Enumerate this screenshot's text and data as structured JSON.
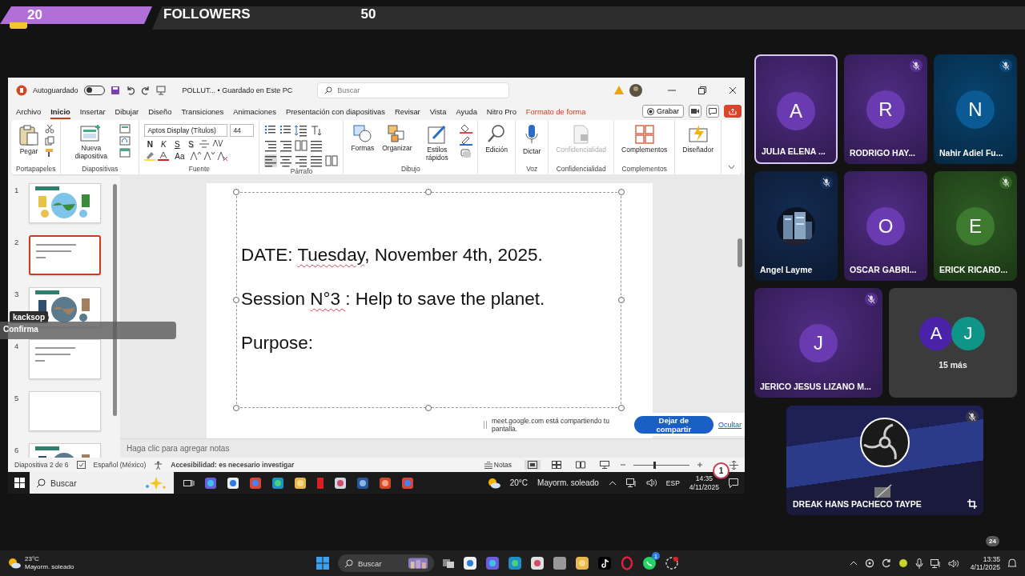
{
  "stream_overlay": {
    "left_count": "20",
    "title": "FOLLOWERS",
    "right_count": "50"
  },
  "powerpoint": {
    "title_bar": {
      "autosave_label": "Autoguardado",
      "autosave_on": false,
      "document": "POLLUT... • Guardado en Este PC",
      "search_placeholder": "Buscar"
    },
    "menu_tabs": [
      {
        "label": "Archivo",
        "selected": false,
        "kind": "tab"
      },
      {
        "label": "Inicio",
        "selected": true,
        "kind": "tab"
      },
      {
        "label": "Insertar",
        "selected": false,
        "kind": "tab"
      },
      {
        "label": "Dibujar",
        "selected": false,
        "kind": "tab"
      },
      {
        "label": "Diseño",
        "selected": false,
        "kind": "tab"
      },
      {
        "label": "Transiciones",
        "selected": false,
        "kind": "tab"
      },
      {
        "label": "Animaciones",
        "selected": false,
        "kind": "tab"
      },
      {
        "label": "Presentación con diapositivas",
        "selected": false,
        "kind": "tab"
      },
      {
        "label": "Revisar",
        "selected": false,
        "kind": "tab"
      },
      {
        "label": "Vista",
        "selected": false,
        "kind": "tab"
      },
      {
        "label": "Ayuda",
        "selected": false,
        "kind": "tab"
      },
      {
        "label": "Nitro Pro",
        "selected": false,
        "kind": "tab"
      },
      {
        "label": "Formato de forma",
        "selected": false,
        "kind": "contextual"
      }
    ],
    "record_button": "Grabar",
    "ribbon_groups": [
      {
        "label": "Portapapeles",
        "kind": "clipboard",
        "buttons": [
          {
            "label": "Pegar",
            "kind": "paste",
            "disabled": false
          }
        ]
      },
      {
        "label": "Diapositivas",
        "kind": "slides",
        "buttons": [
          {
            "label": "Nueva diapositiva",
            "kind": "new-slide",
            "disabled": false
          }
        ]
      },
      {
        "label": "Fuente",
        "kind": "font",
        "font_name": "Aptos Display (Títulos)",
        "font_size": "44",
        "format_buttons": [
          "N",
          "K",
          "S",
          "S"
        ],
        "case_button": "Aa"
      },
      {
        "label": "Párrafo",
        "kind": "paragraph"
      },
      {
        "label": "Dibujo",
        "kind": "drawing",
        "buttons": [
          {
            "label": "Formas",
            "kind": "shapes",
            "disabled": false
          },
          {
            "label": "Organizar",
            "kind": "arrange",
            "disabled": false
          },
          {
            "label": "Estilos rápidos",
            "kind": "styles",
            "disabled": false
          }
        ]
      },
      {
        "kind": "plain",
        "buttons": [
          {
            "label": "Edición",
            "kind": "find",
            "disabled": false
          }
        ]
      },
      {
        "label": "Voz",
        "kind": "plain",
        "buttons": [
          {
            "label": "Dictar",
            "kind": "mic",
            "disabled": false
          }
        ]
      },
      {
        "label": "Confidencialidad",
        "kind": "plain",
        "buttons": [
          {
            "label": "Confidencialidad",
            "kind": "sensitivity",
            "disabled": true
          }
        ]
      },
      {
        "label": "Complementos",
        "kind": "plain",
        "buttons": [
          {
            "label": "Complementos",
            "kind": "addins",
            "disabled": false
          }
        ]
      },
      {
        "kind": "plain",
        "buttons": [
          {
            "label": "Diseñador",
            "kind": "designer",
            "disabled": false
          }
        ]
      }
    ],
    "slides": [
      {
        "number": "1",
        "selected": false,
        "kind": "picture"
      },
      {
        "number": "2",
        "selected": true,
        "kind": "text"
      },
      {
        "number": "3",
        "selected": false,
        "kind": "picture"
      },
      {
        "number": "4",
        "selected": false,
        "kind": "text"
      },
      {
        "number": "5",
        "selected": false,
        "kind": "blank"
      },
      {
        "number": "6",
        "selected": false,
        "kind": "picture"
      }
    ],
    "slide_lines": [
      {
        "segments": [
          {
            "text": "DATE: ",
            "misspelled": false
          },
          {
            "text": "Tuesday",
            "misspelled": true
          },
          {
            "text": ", November 4th, 2025.",
            "misspelled": false
          }
        ]
      },
      {
        "segments": [
          {
            "text": "Session ",
            "misspelled": false
          },
          {
            "text": "N°3 ",
            "misspelled": true
          },
          {
            "text": ": Help to save the planet.",
            "misspelled": false
          }
        ]
      },
      {
        "segments": [
          {
            "text": "Purpose:",
            "misspelled": false
          }
        ]
      }
    ],
    "notes_placeholder": "Haga clic para agregar notas",
    "status_bar": {
      "slide_position": "Diapositiva 2 de 6",
      "language": "Español (México)",
      "accessibility": "Accesibilidad: es necesario investigar",
      "notes_button": "Notas",
      "zoom": {
        "level": 0.35
      }
    },
    "views": [
      {
        "kind": "normal",
        "selected": true
      },
      {
        "kind": "sorter",
        "selected": false
      },
      {
        "kind": "reading",
        "selected": false
      },
      {
        "kind": "slideshow",
        "selected": false
      }
    ]
  },
  "overlay_label": {
    "name": "kacksop",
    "message": "Confirma"
  },
  "share_banner": {
    "message": "meet.google.com está compartiendo tu pantalla.",
    "stop_button": "Dejar de compartir",
    "hide_link": "Ocultar"
  },
  "click_badge": "1",
  "shared_taskbar": {
    "search_placeholder": "Buscar",
    "temperature": "20°C",
    "weather": "Mayorm. soleado",
    "language": "ESP",
    "time": "14:35",
    "date": "4/11/2025"
  },
  "participants": [
    {
      "initial": "A",
      "name": "JULIA ELENA ...",
      "color": "#6a3bb0",
      "muted": false,
      "highlighted": true,
      "kind": "initial"
    },
    {
      "initial": "R",
      "name": "RODRIGO HAY...",
      "color": "#6a3bb0",
      "muted": true,
      "highlighted": false,
      "kind": "initial"
    },
    {
      "initial": "N",
      "name": "Nahir Adiel Fu...",
      "color": "#0b5a94",
      "muted": true,
      "highlighted": false,
      "kind": "initial"
    },
    {
      "name": "Angel Layme",
      "muted": true,
      "highlighted": false
    },
    {
      "initial": "O",
      "name": "OSCAR GABRI...",
      "color": "#6a3bb0",
      "muted": false,
      "highlighted": false,
      "kind": "initial"
    },
    {
      "initial": "E",
      "name": "ERICK RICARD...",
      "color": "#3d7a2f",
      "muted": true,
      "highlighted": false,
      "kind": "initial"
    },
    {
      "initial": "J",
      "name": "JERICO JESUS LIZANO M...",
      "color": "#6a3bb0",
      "muted": true,
      "highlighted": false,
      "kind": "initial"
    }
  ],
  "more_participants": {
    "avatars": [
      {
        "initial": "A",
        "color": "#4b23a8"
      },
      {
        "initial": "J",
        "color": "#0f9488"
      }
    ],
    "label": "15 más"
  },
  "presenter": {
    "name": "DREAK HANS PACHECO TAYPE",
    "muted": true
  },
  "taskbar": {
    "temperature": "23°C",
    "weather": "Mayorm. soleado",
    "search_placeholder": "Buscar",
    "app_badge": "1",
    "notification_count": "24",
    "time": "13:35",
    "date": "4/11/2025"
  }
}
